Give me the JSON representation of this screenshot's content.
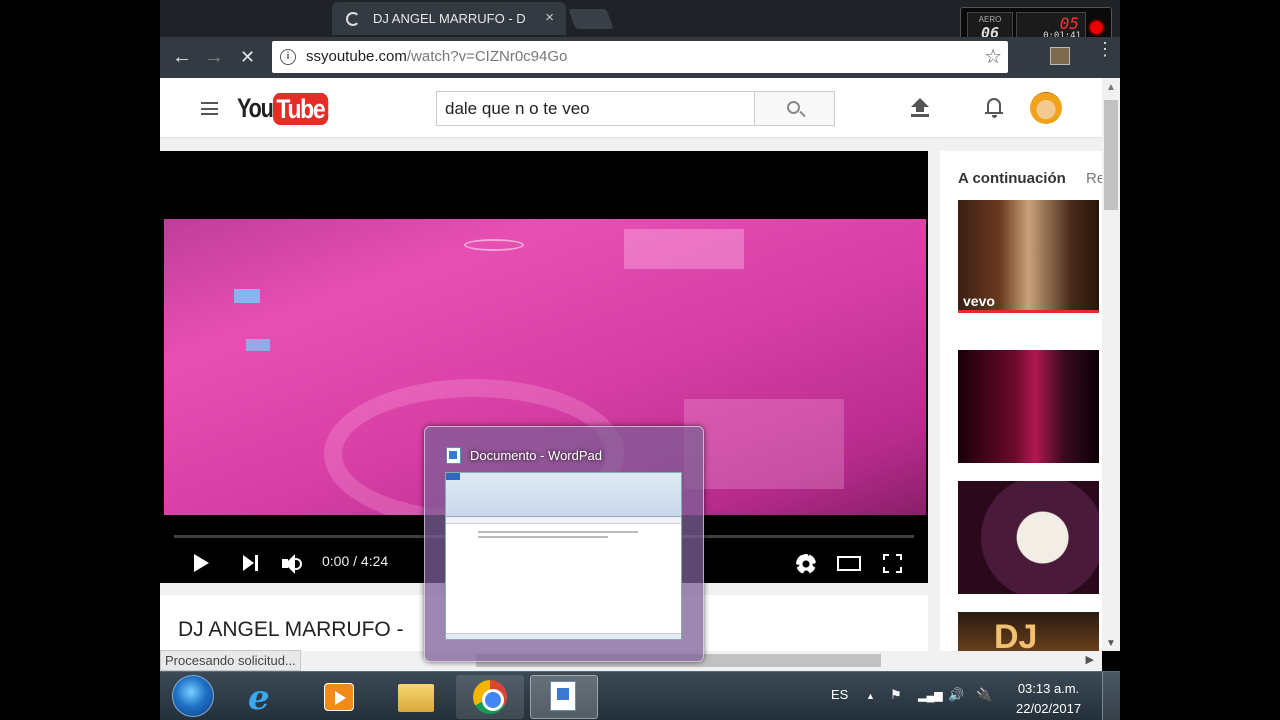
{
  "browser": {
    "tab_title": "DJ ANGEL MARRUFO - D",
    "tab_close": "×",
    "url_host": "ssyoutube.com",
    "url_path": "/watch?v=CIZNr0c94Go",
    "back": "←",
    "forward": "→",
    "stop": "✕",
    "star": "☆",
    "menu": "⋮",
    "status": "Procesando solicitud..."
  },
  "recorder": {
    "aero_label": "AERO",
    "fps": "06",
    "count": "05",
    "elapsed": "0:01:41"
  },
  "youtube": {
    "logo_you": "You",
    "logo_tube": "Tube",
    "search_value": "dale que n o te veo",
    "player": {
      "time": "0:00 / 4:24",
      "progress": 0
    },
    "video_title": "DJ ANGEL MARRUFO -",
    "sidebar": {
      "up_next": "A continuación",
      "autoplay": "Re",
      "thumb1_badge": "vevo",
      "thumb4_text": "DJ"
    }
  },
  "wordpad_preview": {
    "title": "Documento - WordPad"
  },
  "taskbar": {
    "language": "ES",
    "tray_arrow": "▲",
    "time": "03:13 a.m.",
    "date": "22/02/2017"
  },
  "icons": {
    "flag": "⚑",
    "signal": "▂▄▆",
    "volume": "🔊",
    "power": "🔌"
  }
}
